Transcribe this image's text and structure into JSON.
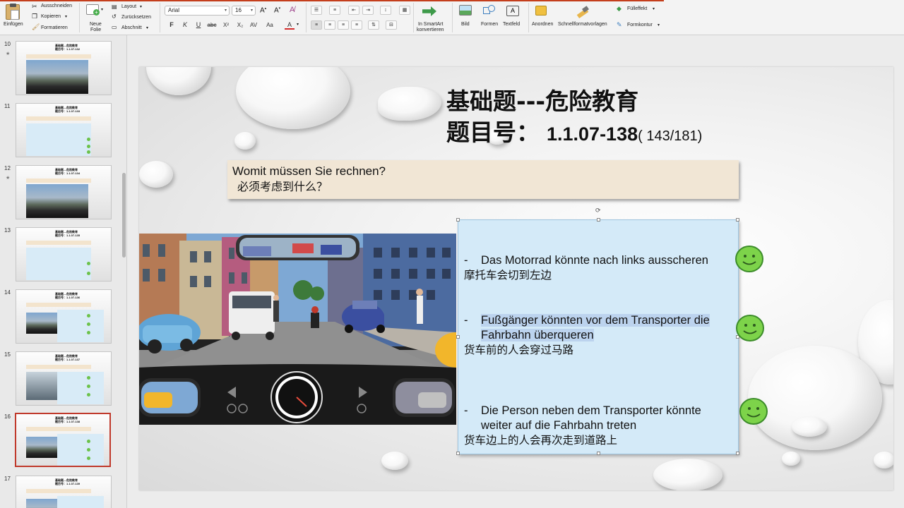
{
  "ribbon": {
    "einfuegen": "Einfügen",
    "ausschneiden": "Ausschneiden",
    "kopieren": "Kopieren",
    "formatieren": "Formatieren",
    "neue_folie_1": "Neue",
    "neue_folie_2": "Folie",
    "layout": "Layout",
    "zuruecksetzen": "Zurücksetzen",
    "abschnitt": "Abschnitt",
    "font_name": "Arial",
    "font_size": "16",
    "smartart_1": "In SmartArt",
    "smartart_2": "konvertieren",
    "bild": "Bild",
    "formen": "Formen",
    "textfeld": "Textfeld",
    "anordnen": "Anordnen",
    "schnellformat": "Schnellformatvorlagen",
    "fuelleffekt": "Fülleffekt",
    "formkontur": "Formkontur"
  },
  "thumbnails": [
    {
      "num": "10",
      "star": true
    },
    {
      "num": "11",
      "star": false
    },
    {
      "num": "12",
      "star": true
    },
    {
      "num": "13",
      "star": false
    },
    {
      "num": "14",
      "star": false
    },
    {
      "num": "15",
      "star": false
    },
    {
      "num": "16",
      "star": false
    },
    {
      "num": "17",
      "star": false
    }
  ],
  "slide": {
    "title_line1": "基础题---危险教育",
    "title_line2_label": "题目号：",
    "title_number": "1.1.07-138",
    "title_count": "( 143/181)",
    "question_de": "Womit müssen Sie rechnen?",
    "question_zh": "必须考虑到什么？",
    "answers": [
      {
        "dash": "-",
        "de_line1": "Das Motorrad könnte nach links ausscheren",
        "de_line2": "",
        "zh": "摩托车会切到左边"
      },
      {
        "dash": "-",
        "de_line1": "Fußgänger könnten vor dem Transporter die",
        "de_line2": "Fahrbahn überqueren",
        "zh": "货车前的人会穿过马路"
      },
      {
        "dash": "-",
        "de_line1": "Die Person neben dem Transporter könnte",
        "de_line2": "weiter auf die Fahrbahn treten",
        "zh": "货车边上的人会再次走到道路上"
      }
    ]
  },
  "colors": {
    "accent_red": "#c43e1c",
    "answer_bg": "#d4eaf8",
    "question_bg": "#f1e6d5",
    "smiley": "#7dd34a",
    "selection_red": "#c0392b"
  }
}
